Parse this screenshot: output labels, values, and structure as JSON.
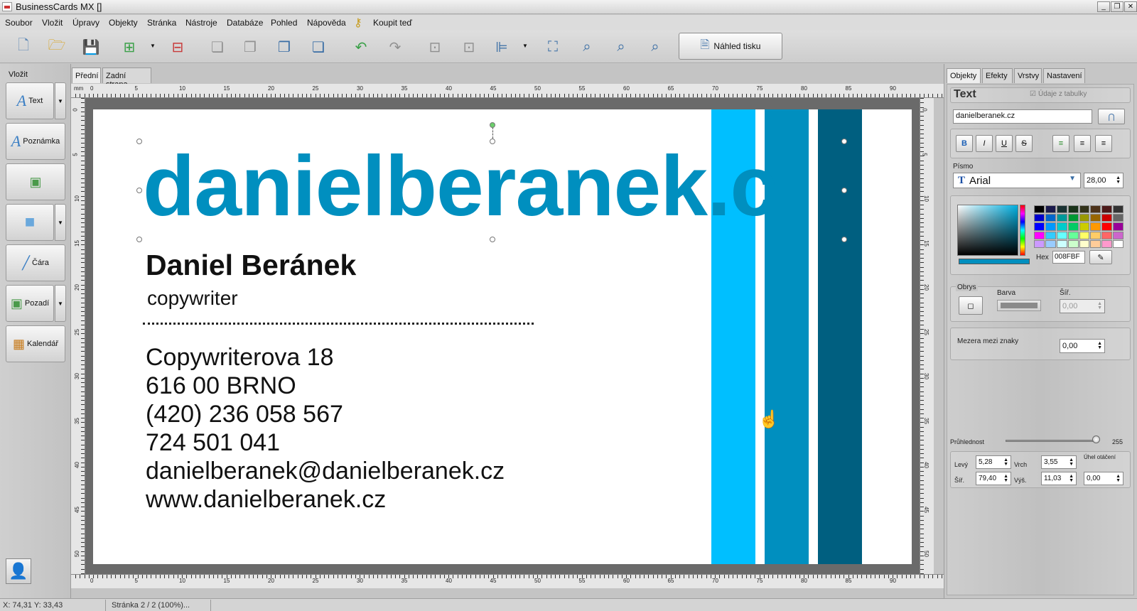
{
  "window": {
    "title": "BusinessCards MX []",
    "buttons": [
      "_",
      "❐",
      "✕"
    ]
  },
  "menu": [
    "Soubor",
    "Vložit",
    "Úpravy",
    "Objekty",
    "Stránka",
    "Nástroje",
    "Databáze",
    "Pohled",
    "Nápověda"
  ],
  "buy_label": "Koupit teď",
  "toolbar": {
    "preview_label": "Náhled tisku"
  },
  "left_panel": {
    "header": "Vložit",
    "items": [
      "Text",
      "Poznámka",
      "",
      "",
      "Čára",
      "Pozadí",
      "Kalendář"
    ]
  },
  "canvas_tabs": [
    "Přední",
    "Zadní strana"
  ],
  "ruler": {
    "unit": "mm",
    "h_ticks": [
      "0",
      "5",
      "10",
      "15",
      "20",
      "25",
      "30",
      "35",
      "40",
      "45",
      "50",
      "55",
      "60",
      "65",
      "70",
      "75",
      "80",
      "85",
      "90"
    ],
    "v_ticks": [
      "0",
      "5",
      "10",
      "15",
      "20",
      "25",
      "30",
      "35",
      "40",
      "45",
      "50"
    ]
  },
  "card": {
    "big_text": "danielberanek.c",
    "name": "Daniel Beránek",
    "role": "copywriter",
    "lines": [
      "Copywriterova 18",
      "616 00  BRNO",
      "(420) 236 058 567",
      "724 501 041",
      "danielberanek@danielberanek.cz",
      "www.danielberanek.cz"
    ],
    "stripe_colors": [
      "#00BFFF",
      "#008FBF",
      "#005F80"
    ]
  },
  "right_panel": {
    "tabs": [
      "Objekty",
      "Efekty",
      "Vrstvy",
      "Nastavení"
    ],
    "title": "Text",
    "table_data_label": "Údaje z tabulky",
    "text_value": "danielberanek.cz",
    "format_buttons": [
      "B",
      "I",
      "U",
      "S"
    ],
    "font_label": "Písmo",
    "font_name": "Arial",
    "font_size": "28,00",
    "hex_label": "Hex",
    "hex_value": "008FBF",
    "outline_label": "Obrys",
    "outline_color_label": "Barva",
    "outline_width_label": "Šíř.",
    "outline_width_value": "0,00",
    "spacing_label": "Mezera mezi znaky",
    "spacing_value": "0,00",
    "opacity_label": "Průhlednost",
    "opacity_value": "255",
    "pos": {
      "left_label": "Levý",
      "left_value": "5,28",
      "top_label": "Vrch",
      "top_value": "3,55",
      "rot_label": "Úhel otáčení",
      "width_label": "Šíř.",
      "width_value": "79,40",
      "height_label": "Výš.",
      "height_value": "11,03",
      "rot_value": "0,00"
    }
  },
  "status": {
    "coords": "X: 74,31 Y: 33,43",
    "page": "Stránka 2 / 2 (100%)..."
  }
}
